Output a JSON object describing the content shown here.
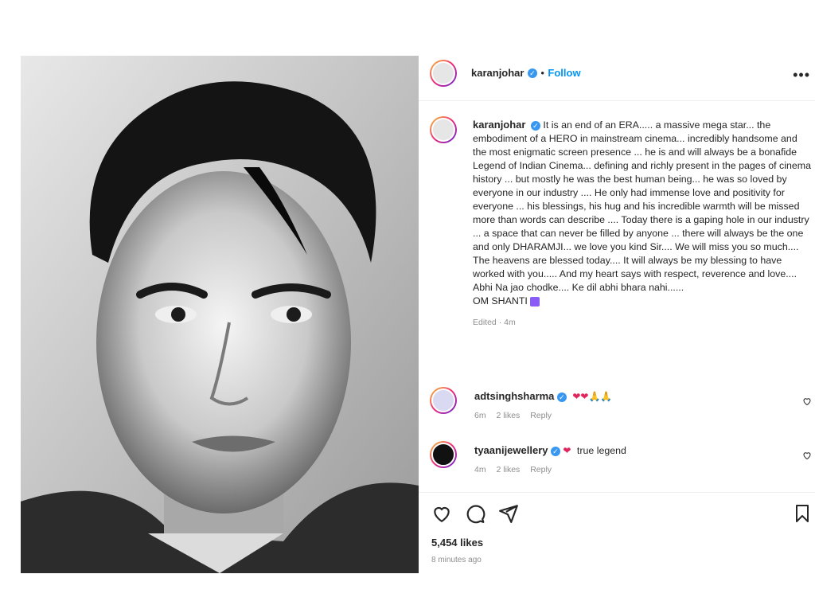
{
  "post": {
    "author": "karanjohar",
    "follow_label": "Follow",
    "separator": "•",
    "more_label": "•••"
  },
  "caption": {
    "username": "karanjohar",
    "text": "It is an end of an ERA..... a massive mega star... the embodiment of a HERO in mainstream cinema... incredibly handsome and the most enigmatic screen presence ... he is and will always be a bonafide Legend of Indian Cinema... defining and richly present in the pages of cinema history ... but mostly he was the best human being... he was so loved by everyone in our industry .... He only had immense love and positivity for everyone ... his blessings, his hug and his incredible warmth will be missed more than words can describe .... Today there is a gaping hole in our industry ... a space that can never be filled by anyone ... there will always be the one and only DHARAMJI... we love you kind Sir.... We will miss you so much.... The heavens are blessed today.... It will always be my blessing to have worked with you..... And my heart says with respect, reverence and love.... Abhi Na jao chodke.... Ke dil abhi bhara nahi......",
    "closing": "OM SHANTI",
    "edited": "Edited · 4m"
  },
  "comments": [
    {
      "username": "adtsinghsharma",
      "text": "❤❤🙏🙏",
      "time": "6m",
      "likes": "2 likes",
      "reply": "Reply"
    },
    {
      "username": "tyaanijewellery",
      "text": "true legend",
      "emoji": "❤",
      "time": "4m",
      "likes": "2 likes",
      "reply": "Reply"
    }
  ],
  "footer": {
    "likes": "5,454 likes",
    "timestamp": "8 minutes ago"
  },
  "icons": {
    "like": "heart-icon",
    "comment": "comment-icon",
    "share": "share-icon",
    "save": "bookmark-icon",
    "verified": "verified-badge-icon",
    "more": "more-options-icon"
  },
  "colors": {
    "follow_blue": "#0095f6",
    "verified_blue": "#3897f0",
    "heart_red": "#e0245e",
    "muted": "#8e8e8e"
  }
}
